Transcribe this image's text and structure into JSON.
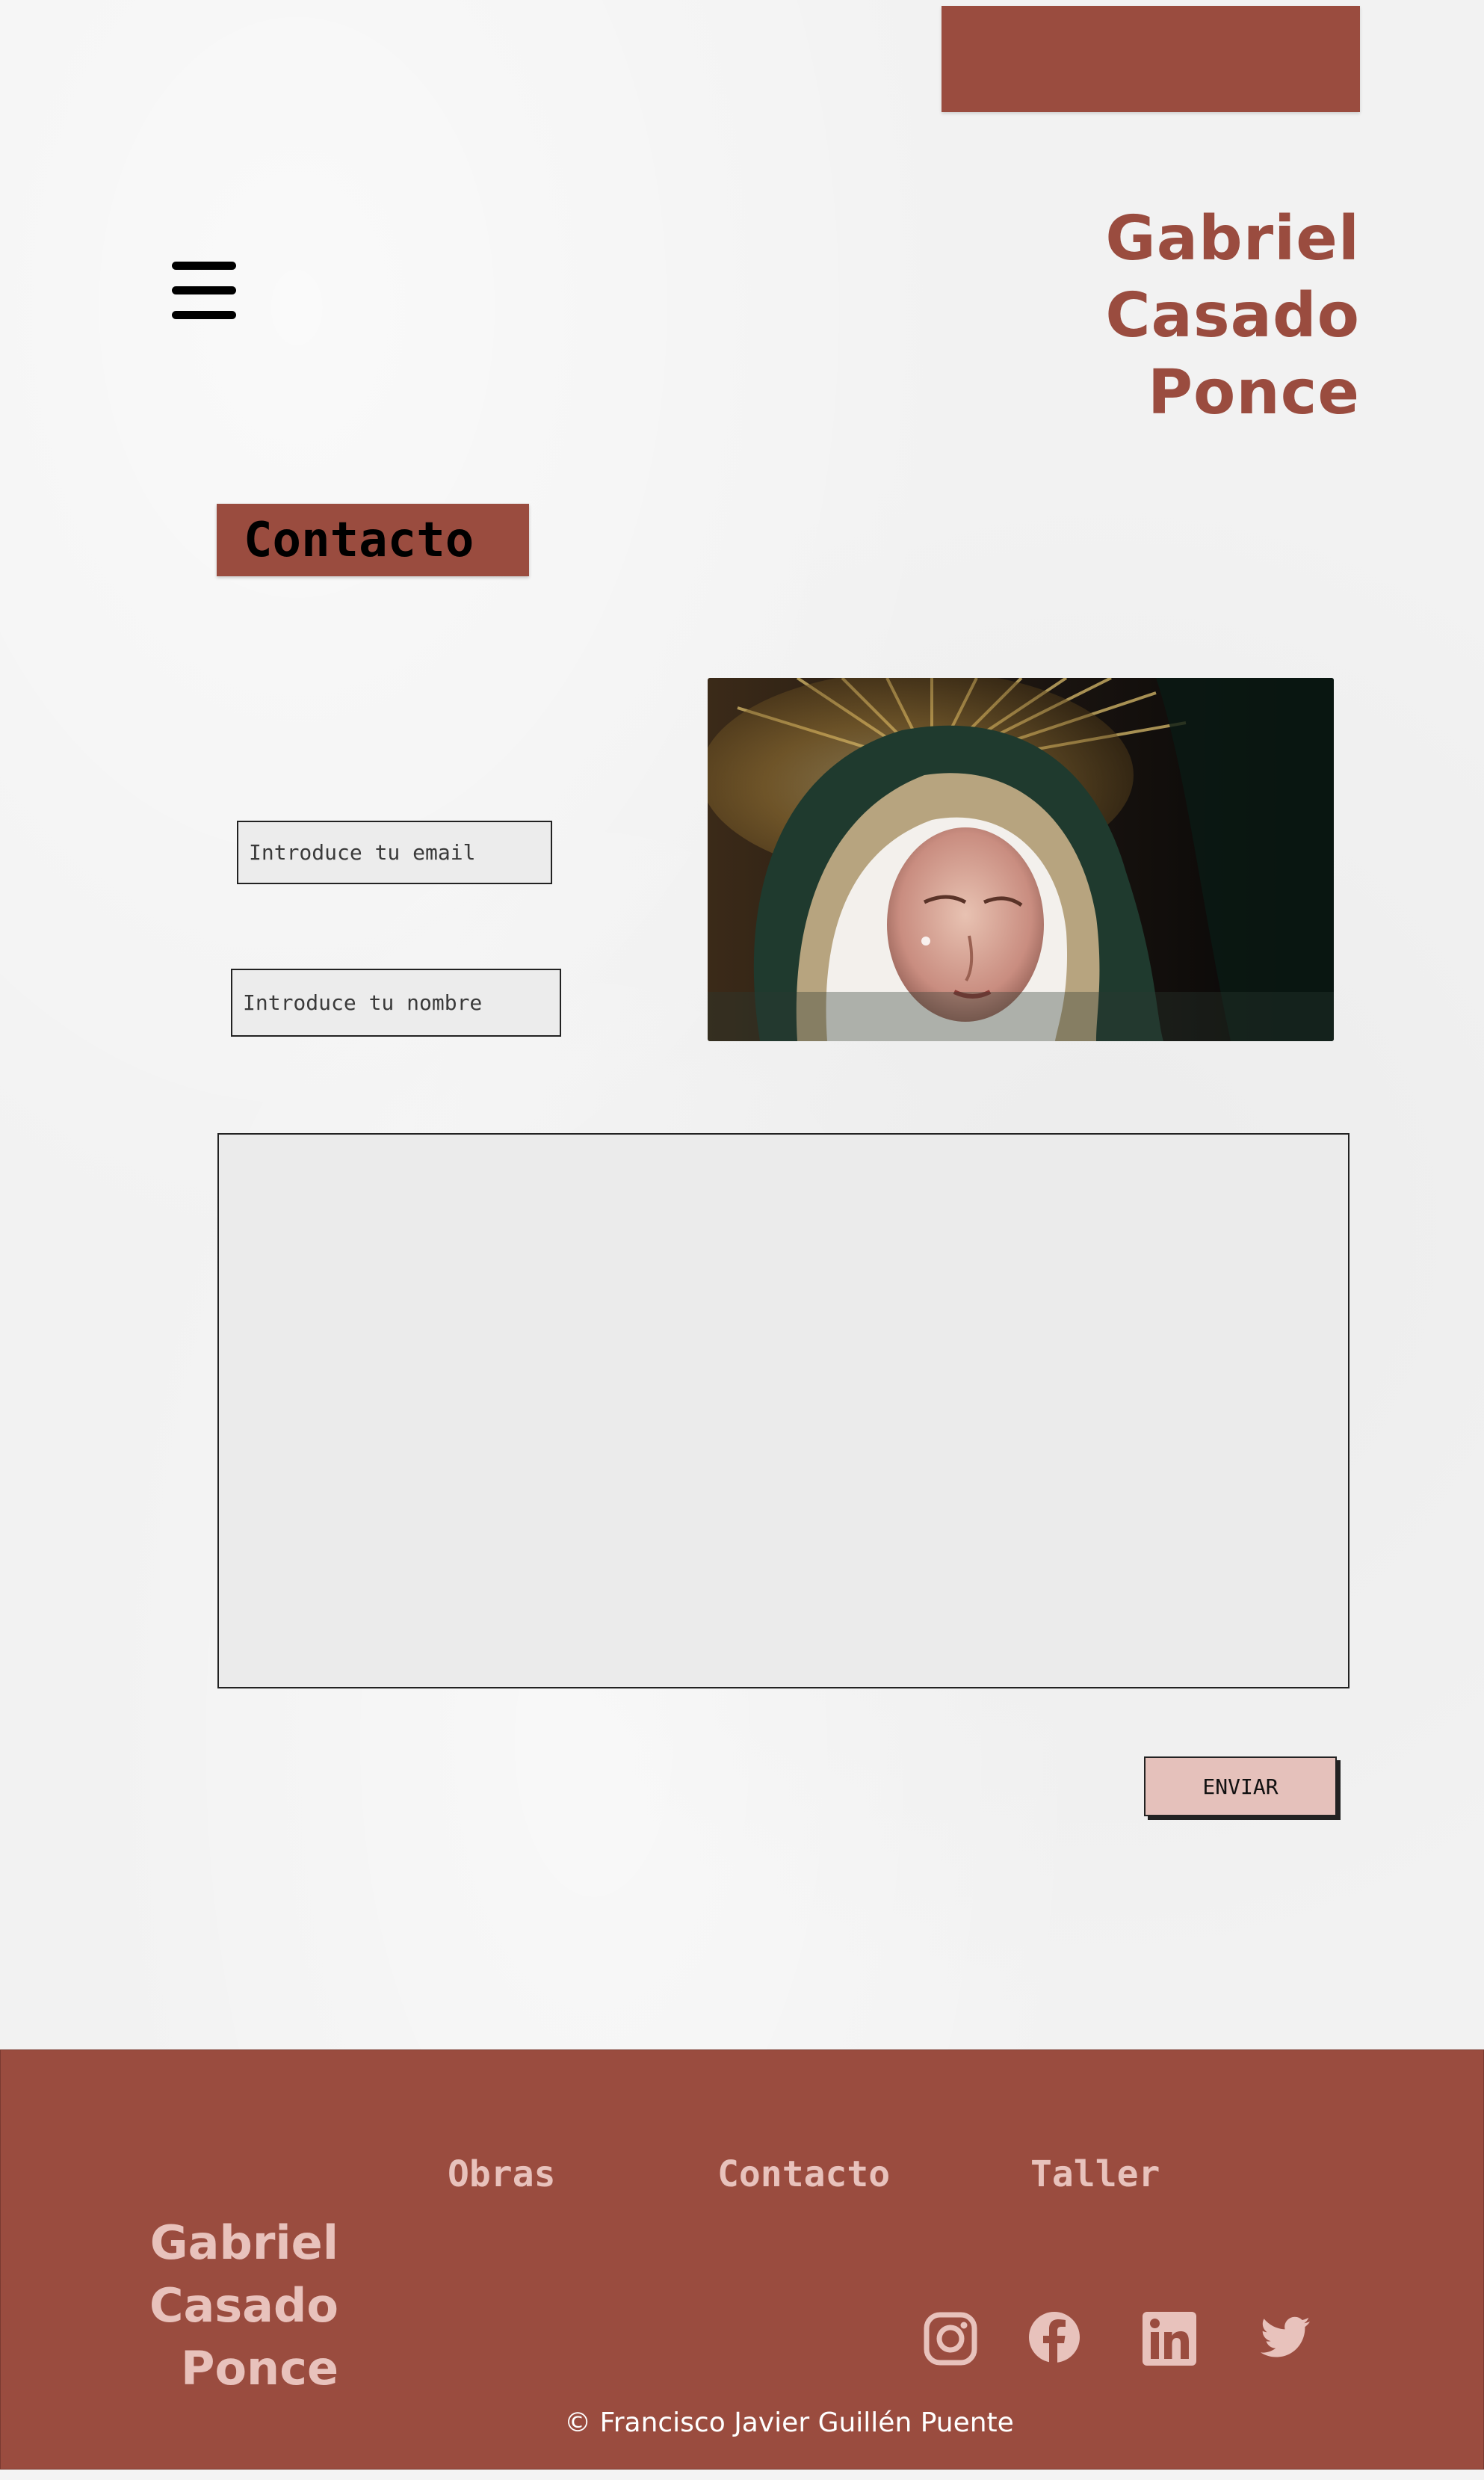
{
  "colors": {
    "brand": "#9a4c3f",
    "brand_light": "#e8c2bc",
    "button_bg": "#e5c1bb",
    "page_bg": "#f2f2f2",
    "field_bg": "#ececec"
  },
  "header": {
    "menu_icon": "hamburger-menu-icon",
    "brand_lines": [
      "Gabriel",
      "Casado",
      "Ponce"
    ]
  },
  "contact": {
    "title": "Contacto",
    "email_placeholder": "Introduce tu email",
    "name_placeholder": "Introduce tu nombre",
    "message_placeholder": "",
    "submit_label": "ENVIAR"
  },
  "footer": {
    "nav": [
      "Obras",
      "Contacto",
      "Taller"
    ],
    "brand_lines": [
      "Gabriel",
      "Casado",
      "Ponce"
    ],
    "social_icons": [
      "instagram-icon",
      "facebook-icon",
      "linkedin-icon",
      "twitter-icon"
    ],
    "copyright": "© Francisco Javier Guillén Puente"
  }
}
